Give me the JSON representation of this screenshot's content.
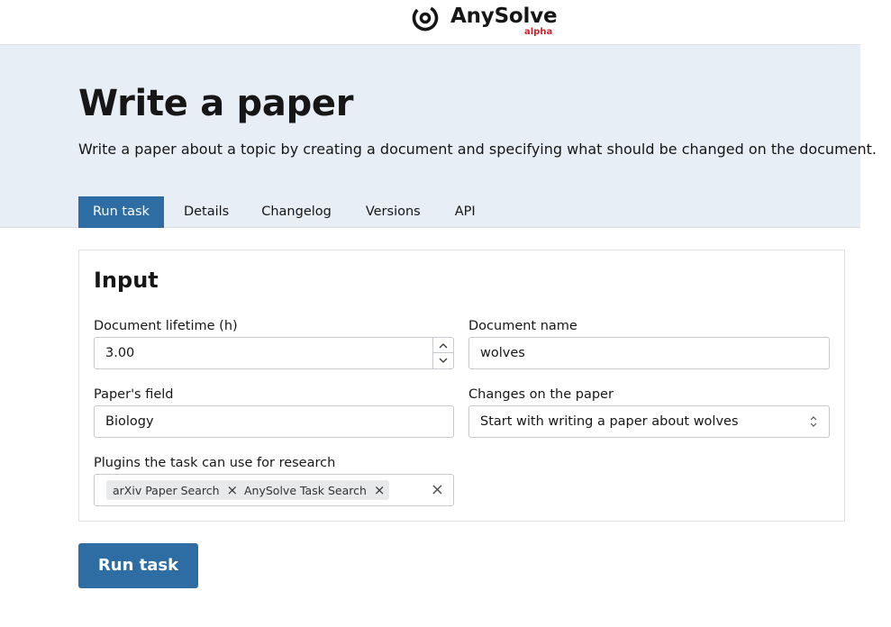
{
  "brand": {
    "name": "AnySolve",
    "tag": "alpha",
    "tag_color": "#da1e28",
    "icon": "anysolve-logo-icon"
  },
  "page": {
    "title": "Write a paper",
    "description": "Write a paper about a topic by creating a document and specifying what should be changed on the document."
  },
  "tabs": [
    {
      "label": "Run task",
      "active": true
    },
    {
      "label": "Details",
      "active": false
    },
    {
      "label": "Changelog",
      "active": false
    },
    {
      "label": "Versions",
      "active": false
    },
    {
      "label": "API",
      "active": false
    }
  ],
  "form": {
    "title": "Input",
    "lifetime": {
      "label": "Document lifetime (h)",
      "value": "3.00",
      "up_icon": "chevron-up-icon",
      "down_icon": "chevron-down-icon"
    },
    "doc_name": {
      "label": "Document name",
      "value": "wolves"
    },
    "field": {
      "label": "Paper's field",
      "value": "Biology"
    },
    "changes": {
      "label": "Changes on the paper",
      "value": "Start with writing a paper about wolves",
      "icon": "select-chevrons-icon"
    },
    "plugins": {
      "label": "Plugins the task can use for research",
      "tags": [
        "arXiv Paper Search",
        "AnySolve Task Search"
      ],
      "remove_icon": "close-icon",
      "clear_icon": "clear-icon"
    }
  },
  "run_button": {
    "label": "Run task"
  },
  "colors": {
    "accent": "#2e6ca4",
    "hero_bg": "#e8eef5"
  }
}
